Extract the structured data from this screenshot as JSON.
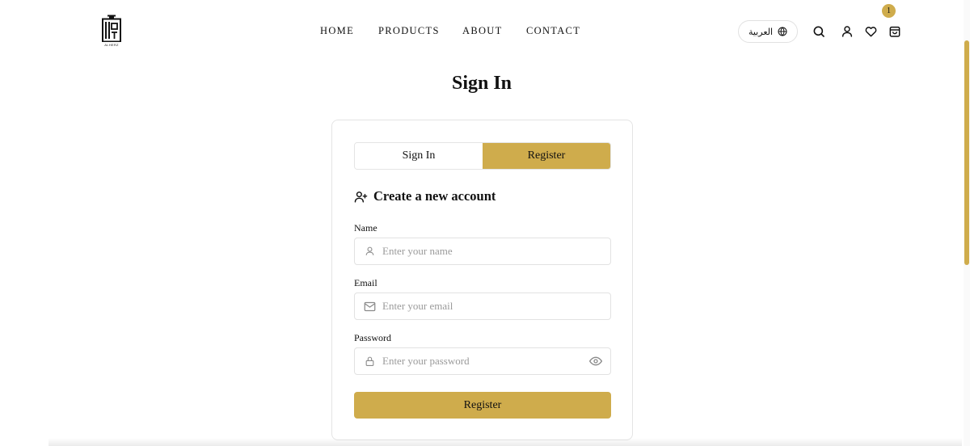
{
  "header": {
    "logo_caption": "ALHERZ",
    "nav": {
      "home": "HOME",
      "products": "PRODUCTS",
      "about": "ABOUT",
      "contact": "CONTACT"
    },
    "language_label": "العربية",
    "cart_count": "1",
    "icons": [
      "globe-icon",
      "search-icon",
      "user-icon",
      "heart-icon",
      "shopping-bag-icon"
    ]
  },
  "page": {
    "title": "Sign In"
  },
  "auth": {
    "tabs": {
      "signin": "Sign In",
      "register": "Register"
    },
    "active_tab": "Register",
    "section_title": "Create a new account",
    "fields": {
      "name": {
        "label": "Name",
        "placeholder": "Enter your name",
        "value": ""
      },
      "email": {
        "label": "Email",
        "placeholder": "Enter your email",
        "value": ""
      },
      "password": {
        "label": "Password",
        "placeholder": "Enter your password",
        "value": ""
      }
    },
    "submit_label": "Register"
  },
  "colors": {
    "accent": "#cfac4c",
    "border": "#e4e4e4",
    "text": "#111111",
    "placeholder": "#9a9a9a"
  }
}
